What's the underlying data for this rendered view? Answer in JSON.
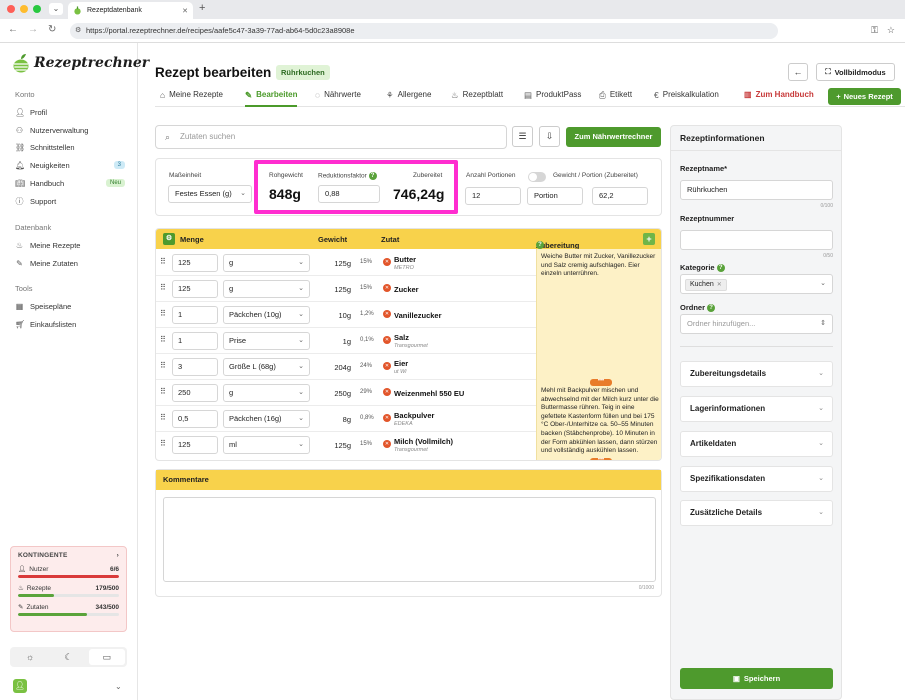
{
  "browser": {
    "tab_title": "Rezeptdatenbank",
    "url": "https://portal.rezeptrechner.de/recipes/aafe5c47-3a39-77ad-ab64-5d0c23a8908e"
  },
  "sidebar": {
    "brand": "Rezeptrechner",
    "sections": {
      "konto": "Konto",
      "datenbank": "Datenbank",
      "tools": "Tools"
    },
    "konto_items": [
      {
        "label": "Profil",
        "icon": "user-icon"
      },
      {
        "label": "Nutzerverwaltung",
        "icon": "users-icon"
      },
      {
        "label": "Schnittstellen",
        "icon": "link-icon"
      },
      {
        "label": "Neuigkeiten",
        "icon": "bell-icon",
        "badge": "3"
      },
      {
        "label": "Handbuch",
        "icon": "book-icon",
        "badge": "Neu"
      },
      {
        "label": "Support",
        "icon": "help-circle-icon"
      }
    ],
    "datenbank_items": [
      {
        "label": "Meine Rezepte",
        "icon": "chef-hat-icon"
      },
      {
        "label": "Meine Zutaten",
        "icon": "carrot-icon"
      }
    ],
    "tools_items": [
      {
        "label": "Speisepläne",
        "icon": "calendar-icon"
      },
      {
        "label": "Einkaufslisten",
        "icon": "cart-icon"
      }
    ],
    "quota": {
      "title": "KONTINGENTE",
      "rows": [
        {
          "label": "Nutzer",
          "value": "6/6",
          "fraction": 1.0,
          "color": "#d93a3a"
        },
        {
          "label": "Rezepte",
          "value": "179/500",
          "fraction": 0.358,
          "color": "#5aa33a"
        },
        {
          "label": "Zutaten",
          "value": "343/500",
          "fraction": 0.686,
          "color": "#5aa33a"
        }
      ]
    }
  },
  "header": {
    "title": "Rezept bearbeiten",
    "badge": "Rührkuchen",
    "fullscreen_label": "Vollbildmodus"
  },
  "tabs": [
    {
      "label": "Meine Rezepte",
      "icon": "home-icon"
    },
    {
      "label": "Bearbeiten",
      "icon": "pencil-icon",
      "active": true
    },
    {
      "label": "Nährwerte",
      "icon": "apple-icon"
    },
    {
      "label": "Allergene",
      "icon": "wheat-icon"
    },
    {
      "label": "Rezeptblatt",
      "icon": "chef-hat-icon"
    },
    {
      "label": "ProduktPass",
      "icon": "document-icon"
    },
    {
      "label": "Etikett",
      "icon": "printer-icon"
    },
    {
      "label": "Preiskalkulation",
      "icon": "euro-icon"
    }
  ],
  "handbook_label": "Zum Handbuch",
  "new_recipe_label": "Neues Rezept",
  "search": {
    "placeholder": "Zutaten suchen",
    "nutrition_button": "Zum Nährwertrechner"
  },
  "settings": {
    "unit_label": "Maßeinheit",
    "unit_value": "Festes Essen (g)",
    "raw_weight_label": "Rohgewicht",
    "raw_weight_value": "848g",
    "reduction_label": "Reduktionsfaktor",
    "reduction_value": "0,88",
    "prepared_label": "Zubereitet",
    "prepared_value": "746,24g",
    "portions_label": "Anzahl Portionen",
    "portions_value": "12",
    "portion_unit": "Portion",
    "weight_per_portion_label": "Gewicht / Portion (Zubereitet)",
    "weight_per_portion_value": "62,2"
  },
  "table": {
    "headers": {
      "amount": "Menge",
      "weight": "Gewicht",
      "ingredient": "Zutat",
      "preparation": "Zubereitung"
    },
    "rows": [
      {
        "amount": "125",
        "unit": "g",
        "weight": "125g",
        "pct": "15%",
        "name": "Butter",
        "sub": "METRO"
      },
      {
        "amount": "125",
        "unit": "g",
        "weight": "125g",
        "pct": "15%",
        "name": "Zucker",
        "sub": ""
      },
      {
        "amount": "1",
        "unit": "Päckchen (10g)",
        "weight": "10g",
        "pct": "1,2%",
        "name": "Vanillezucker",
        "sub": ""
      },
      {
        "amount": "1",
        "unit": "Prise",
        "weight": "1g",
        "pct": "0,1%",
        "name": "Salz",
        "sub": "Transgourmet"
      },
      {
        "amount": "3",
        "unit": "Größe L (68g)",
        "weight": "204g",
        "pct": "24%",
        "name": "Eier",
        "sub": "ut Wi"
      },
      {
        "amount": "250",
        "unit": "g",
        "weight": "250g",
        "pct": "29%",
        "name": "Weizenmehl 550 EU",
        "sub": ""
      },
      {
        "amount": "0,5",
        "unit": "Päckchen (16g)",
        "weight": "8g",
        "pct": "0,8%",
        "name": "Backpulver",
        "sub": "EDEKA"
      },
      {
        "amount": "125",
        "unit": "ml",
        "weight": "125g",
        "pct": "15%",
        "name": "Milch (Vollmilch)",
        "sub": "Transgourmet"
      }
    ],
    "prep_steps": [
      "Weiche Butter mit Zucker, Vanillezucker und Salz cremig aufschlagen. Eier einzeln unterrühren.",
      "Mehl mit Backpulver mischen und abwechselnd mit der Milch kurz unter die Buttermasse rühren. Teig in eine gefettete Kastenform füllen und bei 175 °C Ober-/Unterhitze ca. 50–55 Minuten backen (Stäbchenprobe). 10 Minuten in der Form abkühlen lassen, dann stürzen und vollständig auskühlen lassen."
    ]
  },
  "comments": {
    "title": "Kommentare",
    "counter": "0/1000"
  },
  "info": {
    "title": "Rezeptinformationen",
    "name_label": "Rezeptname*",
    "name_value": "Rührkuchen",
    "name_counter": "0/100",
    "number_label": "Rezeptnummer",
    "number_value": "",
    "number_counter": "0/50",
    "category_label": "Kategorie",
    "category_chip": "Kuchen",
    "folder_label": "Ordner",
    "folder_placeholder": "Ordner hinzufügen...",
    "sections": [
      "Zubereitungsdetails",
      "Lagerinformationen",
      "Artikeldaten",
      "Spezifikationsdaten",
      "Zusätzliche Details"
    ],
    "save_label": "Speichern"
  },
  "colors": {
    "accent_green": "#4e9a2d",
    "table_header_yellow": "#f8d24b",
    "highlight_magenta": "#ff2dd0"
  }
}
